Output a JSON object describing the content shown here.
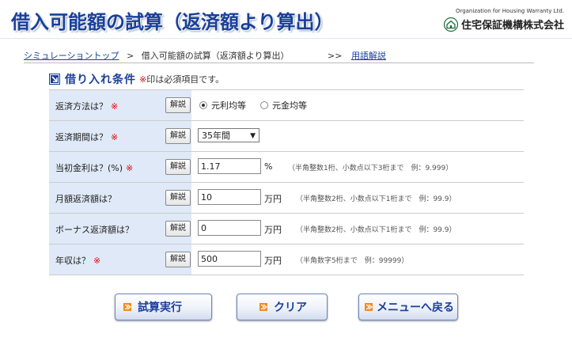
{
  "header": {
    "title": "借入可能額の試算（返済額より算出）",
    "brand_en": "Organization for Housing Warranty Ltd.",
    "brand_name": "住宅保証機構株式会社"
  },
  "breadcrumb": {
    "home": "シミュレーショントップ",
    "separator": ">",
    "current": "借入可能額の試算（返済額より算出）"
  },
  "glossary": {
    "arrow": ">>",
    "label": "用語解説"
  },
  "section": {
    "title": "借り入れ条件",
    "note_mark": "※",
    "note_text": "印は必須項目です。"
  },
  "help_label": "解説",
  "required_mark": "※",
  "form": {
    "repayment_method": {
      "label": "返済方法は？",
      "options": [
        "元利均等",
        "元金均等"
      ],
      "selected": "元利均等"
    },
    "repayment_period": {
      "label": "返済期間は？",
      "value": "35年間"
    },
    "initial_rate": {
      "label": "当初金利は？(%)",
      "value": "1.17",
      "unit": "%",
      "hint": "（半角整数1桁、小数点以下3桁まで　例：9.999）"
    },
    "monthly_payment": {
      "label": "月額返済額は？",
      "value": "10",
      "unit": "万円",
      "hint": "（半角整数2桁、小数点以下1桁まで　例：99.9）"
    },
    "bonus_payment": {
      "label": "ボーナス返済額は？",
      "value": "0",
      "unit": "万円",
      "hint": "（半角整数2桁、小数点以下1桁まで　例：99.9）"
    },
    "annual_income": {
      "label": "年収は？",
      "value": "500",
      "unit": "万円",
      "hint": "（半角数字5桁まで　例：99999）"
    }
  },
  "buttons": {
    "calculate": "試算実行",
    "clear": "クリア",
    "back_to_menu": "メニューへ戻る"
  },
  "colors": {
    "title_blue": "#1a3f9a",
    "label_bg": "#dfe9f7",
    "required_red": "#dd0000",
    "button_icon_orange": "#f08a24"
  }
}
